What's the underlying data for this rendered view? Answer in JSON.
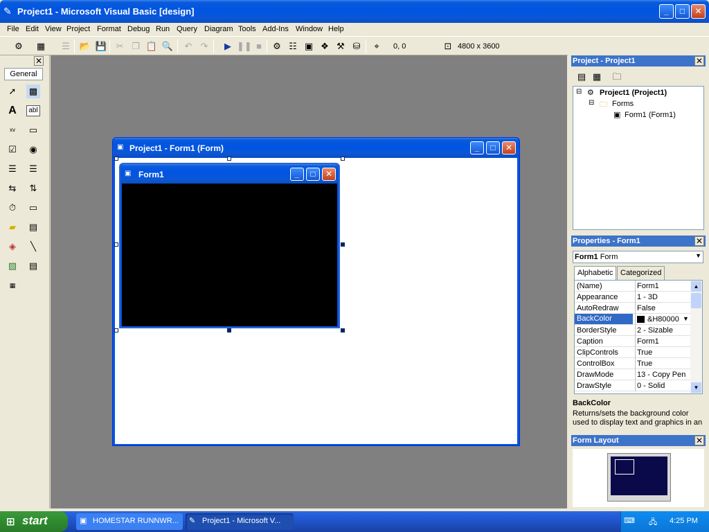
{
  "window": {
    "title": "Project1 - Microsoft Visual Basic [design]"
  },
  "menu": [
    "File",
    "Edit",
    "View",
    "Project",
    "Format",
    "Debug",
    "Run",
    "Query",
    "Diagram",
    "Tools",
    "Add-Ins",
    "Window",
    "Help"
  ],
  "toolbar": {
    "position": "0, 0",
    "size": "4800 x 3600"
  },
  "toolbox": {
    "tab": "General"
  },
  "designer": {
    "title": "Project1 - Form1 (Form)"
  },
  "form": {
    "caption": "Form1"
  },
  "project_panel": {
    "title": "Project - Project1",
    "tree": {
      "root": "Project1 (Project1)",
      "folder": "Forms",
      "item": "Form1 (Form1)"
    }
  },
  "properties_panel": {
    "title": "Properties - Form1",
    "object": "Form1",
    "object_type": "Form",
    "tabs": [
      "Alphabetic",
      "Categorized"
    ],
    "rows": [
      {
        "name": "(Name)",
        "value": "Form1"
      },
      {
        "name": "Appearance",
        "value": "1 - 3D"
      },
      {
        "name": "AutoRedraw",
        "value": "False"
      },
      {
        "name": "BackColor",
        "value": "&H80000"
      },
      {
        "name": "BorderStyle",
        "value": "2 - Sizable"
      },
      {
        "name": "Caption",
        "value": "Form1"
      },
      {
        "name": "ClipControls",
        "value": "True"
      },
      {
        "name": "ControlBox",
        "value": "True"
      },
      {
        "name": "DrawMode",
        "value": "13 - Copy Pen"
      },
      {
        "name": "DrawStyle",
        "value": "0 - Solid"
      }
    ],
    "selected": "BackColor",
    "desc_title": "BackColor",
    "desc_text": "Returns/sets the background color used to display text and graphics in an"
  },
  "form_layout": {
    "title": "Form Layout"
  },
  "taskbar": {
    "start": "start",
    "tasks": [
      "HOMESTAR RUNNWR...",
      "Project1 - Microsoft V..."
    ],
    "clock": "4:25 PM"
  },
  "colors": {
    "accent": "#0054e3",
    "form_back": "#000000",
    "selection": "#316ac5"
  }
}
